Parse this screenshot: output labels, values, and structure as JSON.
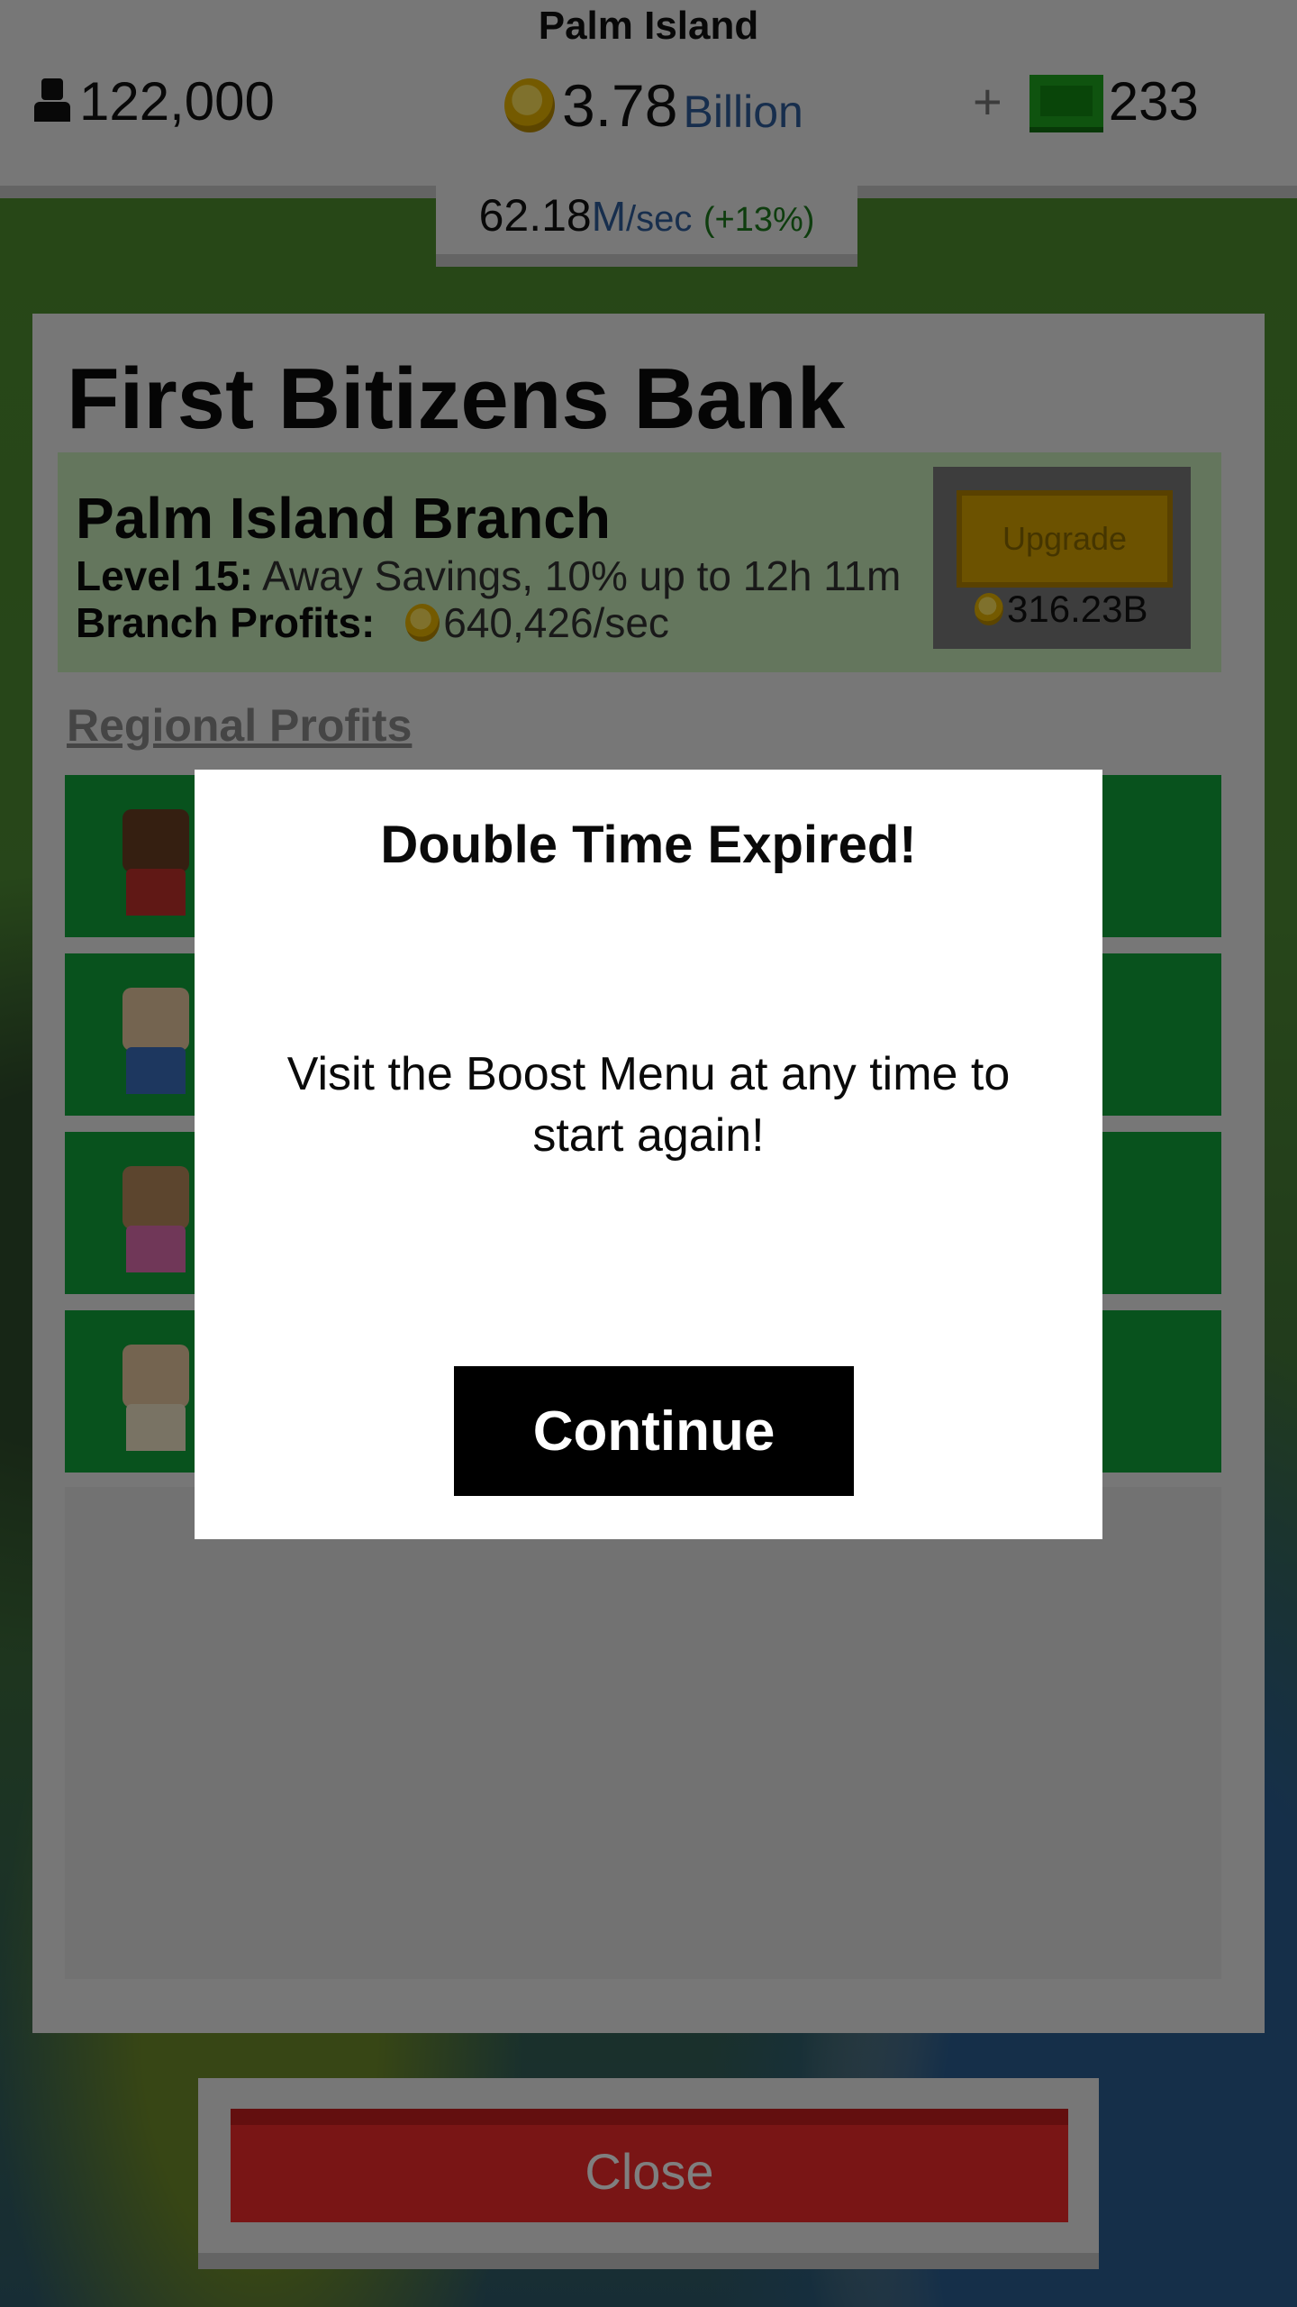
{
  "header": {
    "location": "Palm Island",
    "population": "122,000",
    "money_value": "3.78",
    "money_unit": "Billion",
    "gold_plus": "+",
    "gold_value": "233"
  },
  "rate": {
    "value": "62.18",
    "unit": "M",
    "per": "/sec",
    "boost": "(+13%)"
  },
  "panel": {
    "title": "First Bitizens Bank",
    "branch_name": "Palm Island Branch",
    "level_label": "Level 15:",
    "level_desc": " Away Savings, 10% up to 12h 11m",
    "profits_label": "Branch Profits:",
    "profits_value": "640,426/sec",
    "upgrade_label": "Upgrade",
    "upgrade_cost": "316.23B",
    "regional_label": "Regional Profits"
  },
  "managers": [
    {
      "skin": "#6b3f22",
      "shirt": "#c0302a"
    },
    {
      "skin": "#e9c8a0",
      "shirt": "#3b6fbf"
    },
    {
      "skin": "#b88a5c",
      "shirt": "#e06fb0"
    },
    {
      "skin": "#e9c8a0",
      "shirt": "#f2e6c8"
    }
  ],
  "modal": {
    "title": "Double Time Expired!",
    "body": "Visit the Boost Menu at any time to start again!",
    "continue_label": "Continue"
  },
  "footer": {
    "close_label": "Close"
  }
}
